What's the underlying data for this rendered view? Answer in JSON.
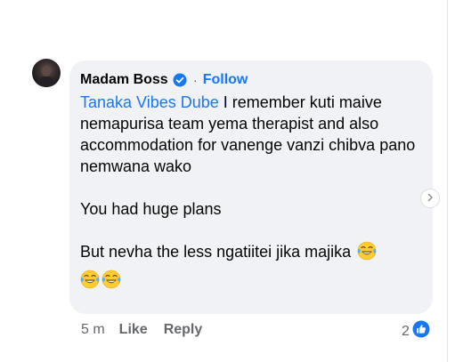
{
  "comment": {
    "author": "Madam Boss",
    "separator": "·",
    "follow_label": "Follow",
    "mention": "Tanaka Vibes Dube",
    "body_line1": " I remember kuti maive nemapurisa team yema therapist and also accommodation for vanenge vanzi chibva pano nemwana wako",
    "body_line2": "You had huge plans",
    "body_line3": "But nevha the less ngatiitei jika majika",
    "emoji_name": "face-with-tears-of-joy-emoji"
  },
  "footer": {
    "time": "5 m",
    "like_label": "Like",
    "reply_label": "Reply",
    "reaction_count": "2"
  },
  "colors": {
    "bubble": "#f0f2f5",
    "link": "#1877f2",
    "meta": "#65676b",
    "text": "#050505"
  }
}
